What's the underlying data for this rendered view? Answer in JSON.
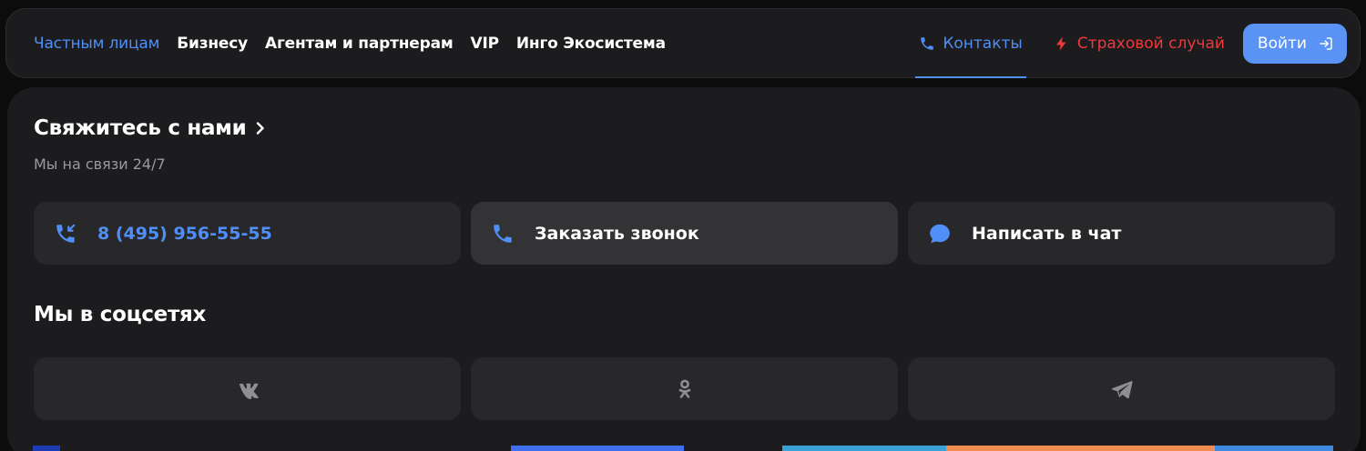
{
  "nav": {
    "links": [
      {
        "label": "Частным лицам",
        "active": true
      },
      {
        "label": "Бизнесу",
        "active": false
      },
      {
        "label": "Агентам и партнерам",
        "active": false
      },
      {
        "label": "VIP",
        "active": false
      },
      {
        "label": "Инго Экосистема",
        "active": false
      }
    ],
    "contacts_label": "Контакты",
    "claim_label": "Страховой случай",
    "login_label": "Войти"
  },
  "contact_section": {
    "title": "Свяжитесь с нами",
    "subtitle": "Мы на связи 24/7",
    "phone": "8 (495) 956-55-55",
    "callback_label": "Заказать звонок",
    "chat_label": "Написать в чат"
  },
  "social_section": {
    "title": "Мы в соцсетях",
    "networks": [
      {
        "icon": "vk-icon"
      },
      {
        "icon": "odnoklassniki-icon"
      },
      {
        "icon": "telegram-icon"
      }
    ]
  },
  "colors": {
    "accent_blue": "#4f8ff7",
    "claim_red": "#f0383b",
    "login_button": "#5b93f5",
    "panel_bg": "#1c1c1e",
    "card_bg": "#28282b",
    "social_icon": "#8e8e93"
  }
}
